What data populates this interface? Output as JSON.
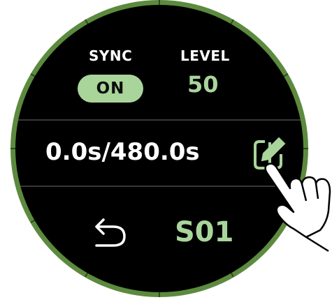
{
  "sync": {
    "label": "SYNC",
    "value": "ON"
  },
  "level": {
    "label": "LEVEL",
    "value": "50"
  },
  "playback": {
    "time": "0.0s/480.0s"
  },
  "scene": {
    "value": "S01"
  },
  "icons": {
    "edit": "edit-icon",
    "back": "back-arrow-icon",
    "hand": "pointing-hand-icon"
  },
  "colors": {
    "ring": "#5c8a3e",
    "accent": "#a9d59b",
    "background": "#000000"
  }
}
